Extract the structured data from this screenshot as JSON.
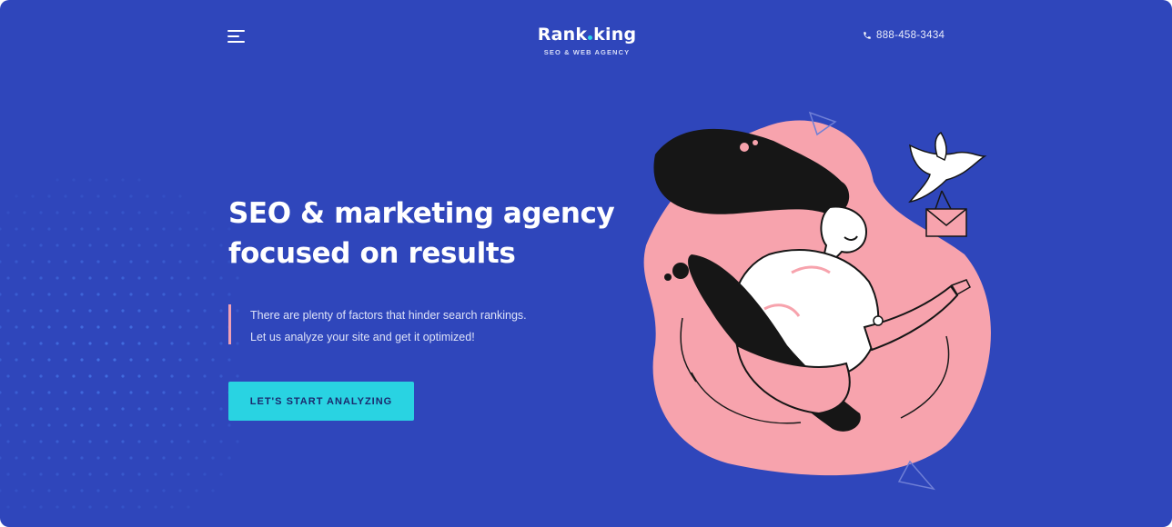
{
  "header": {
    "brand": {
      "part1": "Rank",
      "part2": "king",
      "tagline": "SEO & WEB AGENCY"
    },
    "phone": "888-458-3434"
  },
  "hero": {
    "headline_line1": "SEO & marketing agency",
    "headline_line2": "focused on results",
    "description_line1": "There are plenty of factors that hinder search rankings.",
    "description_line2": "Let us analyze your site and get it optimized!",
    "cta_label": "LET'S START ANALYZING"
  },
  "colors": {
    "background": "#2f46bb",
    "accent": "#29d3e2",
    "blob": "#f7a3ad",
    "quote_bar": "#f0a0b4",
    "text": "#ffffff"
  },
  "icons": {
    "menu": "hamburger-menu-icon",
    "phone": "phone-icon",
    "logo_dot": "brand-dot-icon"
  }
}
